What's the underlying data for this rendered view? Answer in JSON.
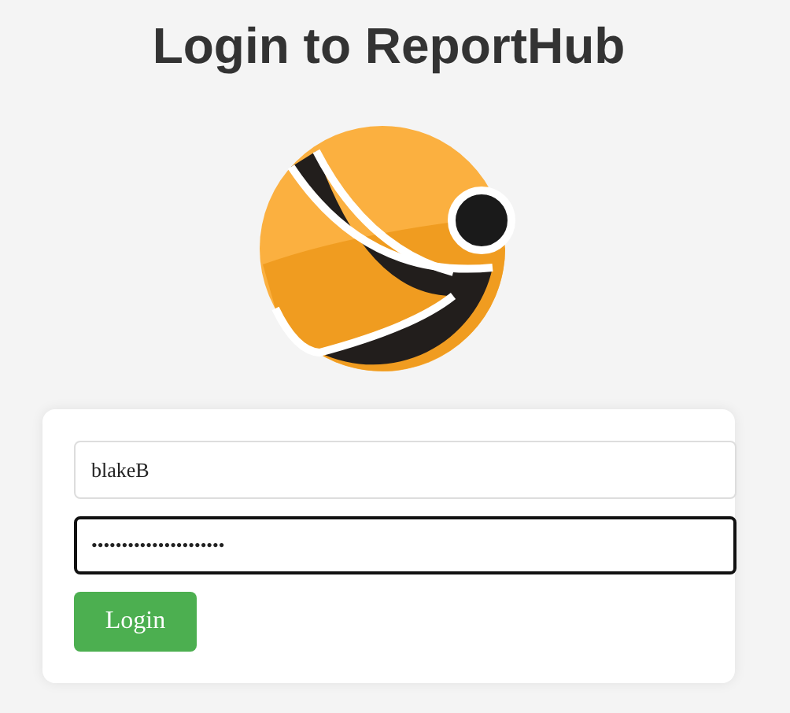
{
  "title": "Login to ReportHub",
  "fields": [
    {
      "value": "blakeB",
      "focused": false
    },
    {
      "value": "••••••••••••••••••••••",
      "focused": true
    }
  ],
  "button": "Login"
}
